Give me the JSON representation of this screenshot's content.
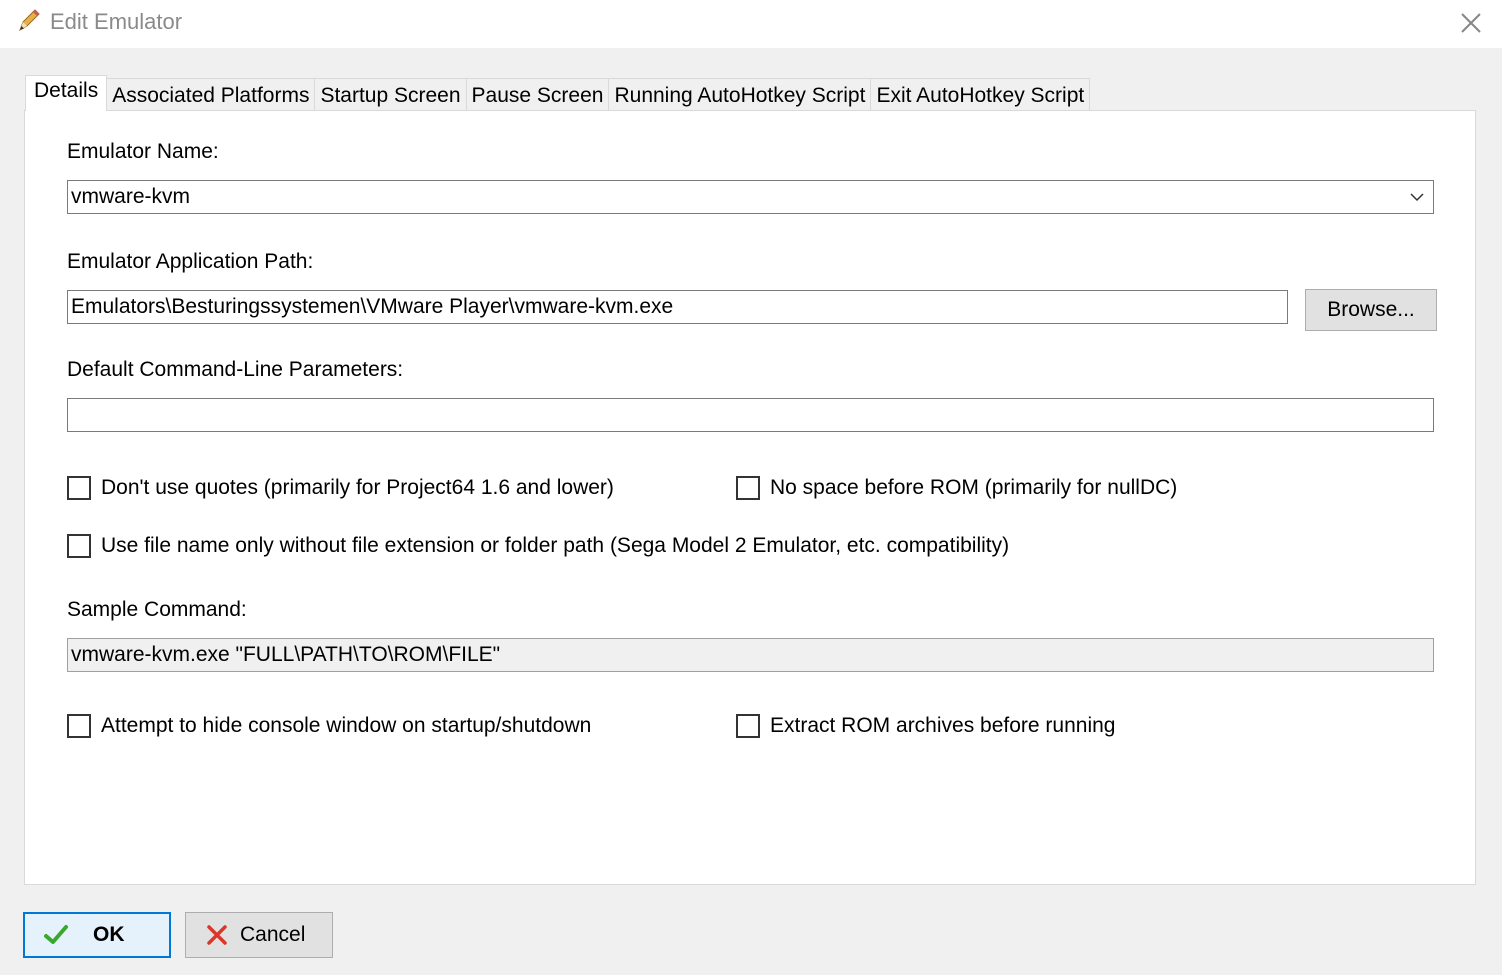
{
  "window": {
    "title": "Edit Emulator",
    "title_icon": "pencil-icon",
    "close_icon": "close-icon"
  },
  "tabs": [
    {
      "label": "Details",
      "active": true
    },
    {
      "label": "Associated Platforms",
      "active": false
    },
    {
      "label": "Startup Screen",
      "active": false
    },
    {
      "label": "Pause Screen",
      "active": false
    },
    {
      "label": "Running AutoHotkey Script",
      "active": false
    },
    {
      "label": "Exit AutoHotkey Script",
      "active": false
    }
  ],
  "form": {
    "emulator_name_label": "Emulator Name:",
    "emulator_name_value": "vmware-kvm",
    "app_path_label": "Emulator Application Path:",
    "app_path_value": "Emulators\\Besturingssystemen\\VMware Player\\vmware-kvm.exe",
    "browse_label": "Browse...",
    "params_label": "Default Command-Line Parameters:",
    "params_value": "",
    "checkboxes": {
      "no_quotes": {
        "label": "Don't use quotes (primarily for Project64 1.6 and lower)",
        "checked": false
      },
      "no_space": {
        "label": "No space before ROM (primarily for nullDC)",
        "checked": false
      },
      "file_name_only": {
        "label": "Use file name only without file extension or folder path (Sega Model 2 Emulator, etc. compatibility)",
        "checked": false
      },
      "hide_console": {
        "label": "Attempt to hide console window on startup/shutdown",
        "checked": false
      },
      "extract_rom": {
        "label": "Extract ROM archives before running",
        "checked": false
      }
    },
    "sample_label": "Sample Command:",
    "sample_value": "vmware-kvm.exe \"FULL\\PATH\\TO\\ROM\\FILE\""
  },
  "buttons": {
    "ok_label": "OK",
    "ok_icon": "checkmark-icon",
    "cancel_label": "Cancel",
    "cancel_icon": "x-icon"
  },
  "colors": {
    "accent": "#0078d7",
    "ok_check": "#3aa82a",
    "cancel_x": "#d9372c"
  }
}
